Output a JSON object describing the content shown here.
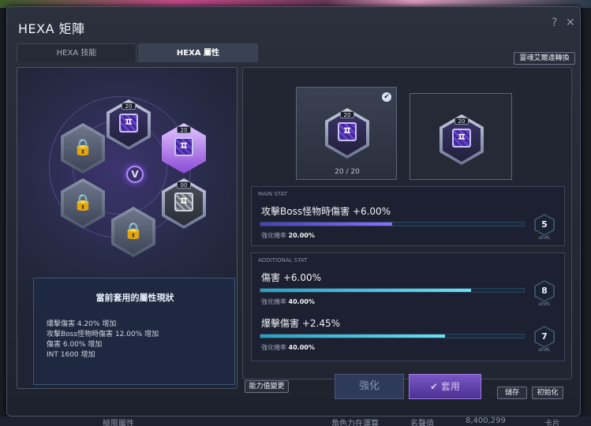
{
  "window": {
    "title": "HEXA 矩陣",
    "help": "?",
    "close": "✕"
  },
  "tabs": [
    {
      "label": "HEXA 技能"
    },
    {
      "label": "HEXA 屬性"
    }
  ],
  "soul_button": "靈魂艾爾達轉換",
  "matrix": {
    "center_symbol": "V",
    "cores": [
      {
        "level": "20",
        "rune": "ㅍ"
      },
      {
        "level": "20",
        "rune": "ㅍ"
      },
      {
        "level": "00",
        "rune": "ㅍ"
      }
    ]
  },
  "status": {
    "title": "當前套用的屬性現狀",
    "lines": [
      "爆擊傷害 4.20% 增加",
      "攻擊Boss怪物時傷害 12.00% 增加",
      "傷害 6.00% 增加",
      "INT 1600 增加"
    ]
  },
  "ability_button": "能力值變更",
  "core_cards": {
    "selected": {
      "level": "20",
      "rune": "ㅍ",
      "progress": "20 / 20",
      "check": "✔"
    },
    "other": {
      "level": "20",
      "rune": "ㅍ"
    }
  },
  "main_stat": {
    "header": "MAIN STAT",
    "name": "攻擊Boss怪物時傷害 +6.00%",
    "rate_label": "強化機率",
    "rate_value": "20.00%",
    "level": "5",
    "level_word": "LEVEL",
    "fill": 0.5
  },
  "additional_stat": {
    "header": "ADDITIONAL STAT",
    "items": [
      {
        "name": "傷害 +6.00%",
        "rate_label": "強化機率",
        "rate_value": "40.00%",
        "level": "8",
        "level_word": "LEVEL",
        "fill": 0.8
      },
      {
        "name": "爆擊傷害 +2.45%",
        "rate_label": "強化機率",
        "rate_value": "40.00%",
        "level": "7",
        "level_word": "LEVEL",
        "fill": 0.7
      }
    ]
  },
  "actions": {
    "enhance": "強化",
    "apply": "✔ 套用",
    "save": "儲存",
    "reset": "初始化"
  },
  "background": {
    "bottom_left": "極限屬性",
    "bottom_mid": "角色力在運算",
    "bottom_right": "名聲值",
    "bottom_num": "8,400,299",
    "bottom_end": "卡片"
  },
  "colors": {
    "accent_purple": "#8a5aff",
    "bar_cyan": "#6ae0f0"
  }
}
